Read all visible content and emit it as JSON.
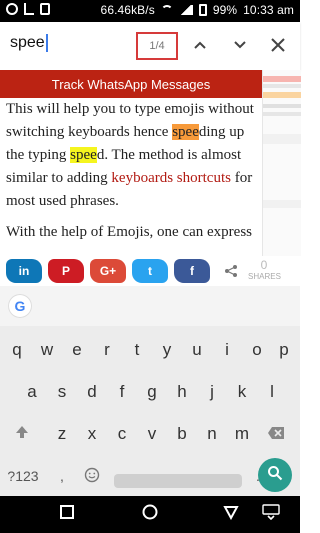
{
  "status_bar": {
    "speed": "66.46kB/s",
    "battery_percent": "99%",
    "time": "10:33 am"
  },
  "find_bar": {
    "query": "spee",
    "match_counter": "1/4"
  },
  "banner": {
    "text": "Track WhatsApp Messages"
  },
  "article": {
    "line1": "This will help you to type emojis without",
    "line2_pre": "switching keyboards hence ",
    "line2_hl": "spee",
    "line2_post": "ding up",
    "line3_pre": "the typing ",
    "line3_hl": "spee",
    "line3_post": "d. The method is almost",
    "line4_pre": "similar to adding ",
    "line4_link": "keyboards shortcuts",
    "line4_post": " for",
    "line5": "most used phrases.",
    "line6": "With the help of Emojis, one can express"
  },
  "share_bar": {
    "count": "0",
    "count_label": "SHARES"
  },
  "keyboard": {
    "row1": [
      "q",
      "w",
      "e",
      "r",
      "t",
      "y",
      "u",
      "i",
      "o",
      "p"
    ],
    "row2": [
      "a",
      "s",
      "d",
      "f",
      "g",
      "h",
      "j",
      "k",
      "l"
    ],
    "row3": [
      "z",
      "x",
      "c",
      "v",
      "b",
      "n",
      "m"
    ],
    "sym_label": "?123",
    "comma": ",",
    "period": ".",
    "g_logo": "G"
  },
  "icons": {
    "linkedin": "in",
    "pinterest": "P",
    "google_plus": "G+",
    "twitter": "t",
    "facebook": "f"
  }
}
